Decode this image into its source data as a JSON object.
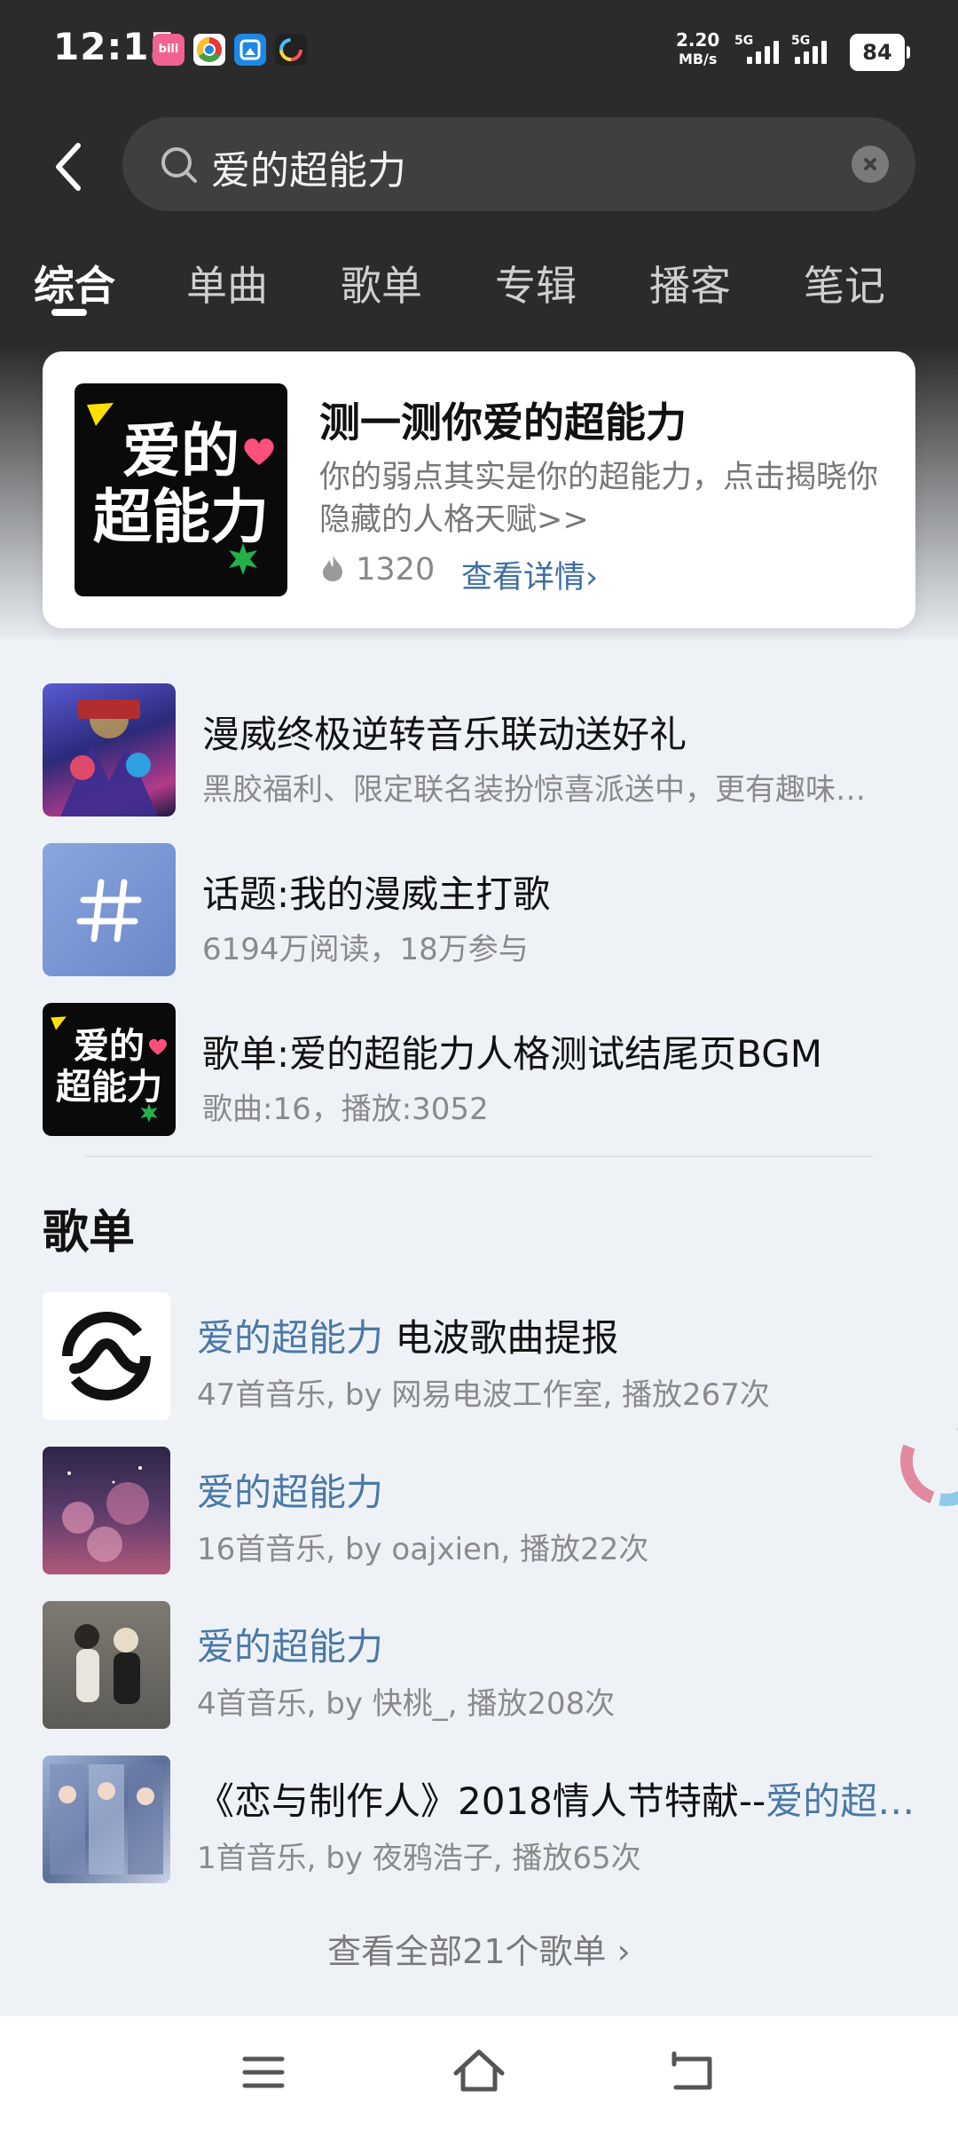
{
  "status_bar": {
    "time": "12:15",
    "app_icons": [
      "bilibili-icon",
      "chrome-icon",
      "app-icon",
      "colorful-ring-icon"
    ],
    "net_speed_value": "2.20",
    "net_speed_unit": "MB/s",
    "sim1": "5G",
    "sim2": "5G",
    "battery": "84"
  },
  "search": {
    "query": "爱的超能力",
    "icons": {
      "back": "back-arrow-icon",
      "search": "search-icon",
      "clear": "clear-icon"
    }
  },
  "tabs": [
    {
      "label": "综合",
      "active": true
    },
    {
      "label": "单曲",
      "active": false
    },
    {
      "label": "歌单",
      "active": false
    },
    {
      "label": "专辑",
      "active": false
    },
    {
      "label": "播客",
      "active": false
    },
    {
      "label": "笔记",
      "active": false
    }
  ],
  "feature_card": {
    "cover_text_line1": "爱的",
    "cover_text_line2": "超能力",
    "title": "测一测你爱的超能力",
    "description": "你的弱点其实是你的超能力，点击揭晓你隐藏的人格天赋>>",
    "heat_icon": "flame-icon",
    "heat_count": "1320",
    "link_label": "查看详情",
    "link_arrow": "›"
  },
  "results": [
    {
      "title": "漫威终极逆转音乐联动送好礼",
      "subtitle": "黑胶福利、限定联名装扮惊喜派送中，更有趣味…",
      "thumb": "marvel-poster"
    },
    {
      "title": "话题:我的漫威主打歌",
      "subtitle": "6194万阅读，18万参与",
      "thumb": "hashtag-icon"
    },
    {
      "title": "歌单:爱的超能力人格测试结尾页BGM",
      "subtitle": "歌曲:16，播放:3052",
      "thumb": "love-superpower-cover",
      "cover_text_line1": "爱的",
      "cover_text_line2": "超能力"
    }
  ],
  "playlists_section": {
    "title": "歌单",
    "items": [
      {
        "highlight": "爱的超能力",
        "title_rest": " 电波歌曲提报",
        "subtitle": "47首音乐, by 网易电波工作室, 播放267次",
        "thumb": "wave-logo-icon"
      },
      {
        "highlight": "爱的超能力",
        "title_rest": "",
        "subtitle": "16首音乐, by oajxien, 播放22次",
        "thumb": "purple-sky-cover"
      },
      {
        "highlight": "爱的超能力",
        "title_rest": "",
        "subtitle": "4首音乐, by 快桃_, 播放208次",
        "thumb": "couple-photo-cover"
      },
      {
        "title_prefix": "《恋与制作人》2018情人节特献--",
        "highlight": "爱的超…",
        "subtitle": "1首音乐, by 夜鸦浩子, 播放65次",
        "thumb": "anime-collage-cover"
      }
    ],
    "view_all": "查看全部21个歌单",
    "view_all_arrow": "›"
  },
  "nav_bar": {
    "icons": [
      "menu-icon",
      "home-icon",
      "back-icon"
    ]
  },
  "colors": {
    "header_bg": "#2b2b2b",
    "page_bg": "#eef2f6",
    "highlight_blue": "#4a79a8",
    "link_blue": "#3d6ea3"
  }
}
